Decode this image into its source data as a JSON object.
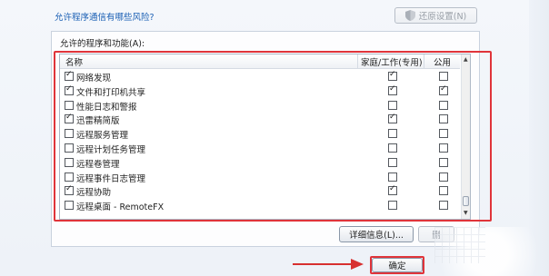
{
  "header": {
    "risk_link": "允许程序通信有哪些风险?",
    "restore_button": "还原设置(N)"
  },
  "group": {
    "label": "允许的程序和功能(A):"
  },
  "list": {
    "columns": [
      "名称",
      "家庭/工作(专用)",
      "公用"
    ],
    "rows": [
      {
        "name": "网络发现",
        "enabled": true,
        "home_work": true,
        "public": false
      },
      {
        "name": "文件和打印机共享",
        "enabled": true,
        "home_work": true,
        "public": true
      },
      {
        "name": "性能日志和警报",
        "enabled": false,
        "home_work": false,
        "public": false
      },
      {
        "name": "迅雷精简版",
        "enabled": true,
        "home_work": true,
        "public": false
      },
      {
        "name": "远程服务管理",
        "enabled": false,
        "home_work": false,
        "public": false
      },
      {
        "name": "远程计划任务管理",
        "enabled": false,
        "home_work": false,
        "public": false
      },
      {
        "name": "远程卷管理",
        "enabled": false,
        "home_work": false,
        "public": false
      },
      {
        "name": "远程事件日志管理",
        "enabled": false,
        "home_work": false,
        "public": false
      },
      {
        "name": "远程协助",
        "enabled": true,
        "home_work": true,
        "public": false
      },
      {
        "name": "远程桌面 - RemoteFX",
        "enabled": false,
        "home_work": false,
        "public": false
      }
    ]
  },
  "buttons": {
    "details": "详细信息(L)...",
    "remove": "删",
    "ok": "确定"
  },
  "colors": {
    "highlight_frame": "#e0343a",
    "link": "#1a5fb4"
  }
}
